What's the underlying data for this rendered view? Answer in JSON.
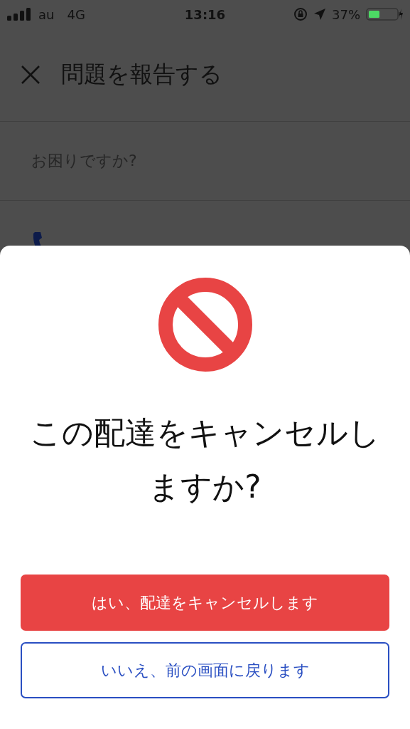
{
  "status_bar": {
    "carrier": "au",
    "network": "4G",
    "time": "13:16",
    "battery": "37%"
  },
  "header": {
    "title": "問題を報告する"
  },
  "section": {
    "title": "お困りですか?"
  },
  "dialog": {
    "title": "この配達をキャンセルしますか?",
    "buttons": [
      {
        "kind": "primary",
        "label": "はい、配達をキャンセルします"
      },
      {
        "kind": "secondary",
        "label": "いいえ、前の画面に戻ります"
      }
    ]
  }
}
